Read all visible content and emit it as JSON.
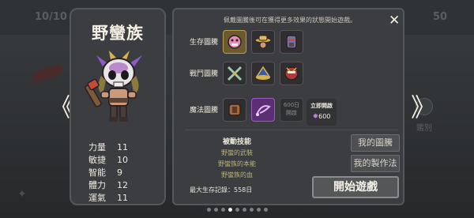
{
  "background": {
    "count_left": "10/10",
    "count_right": "50",
    "badge_label": "鑑別"
  },
  "nav": {
    "prev": "《",
    "next": "》"
  },
  "character": {
    "name": "野蠻族",
    "stats": [
      {
        "label": "力量",
        "value": "11"
      },
      {
        "label": "敏捷",
        "value": "10"
      },
      {
        "label": "智能",
        "value": "9"
      },
      {
        "label": "體力",
        "value": "12"
      },
      {
        "label": "運氣",
        "value": "11"
      }
    ]
  },
  "panel": {
    "hint": "佩戴圖騰後可在獲得更多效果的狀態開始遊戲。",
    "close": "✕",
    "categories": [
      {
        "label": "生存圖騰",
        "icons": [
          "pink-monster-totem-icon",
          "straw-hat-totem-icon",
          "armored-warrior-totem-icon"
        ]
      },
      {
        "label": "戰鬥圖騰",
        "icons": [
          "crossed-swords-totem-icon",
          "mage-hat-totem-icon",
          "red-mask-totem-icon"
        ]
      },
      {
        "label": "魔法圖騰",
        "icons": [
          "bronze-armor-totem-icon",
          "purple-whip-totem-icon"
        ]
      }
    ],
    "locked_cost": "600日",
    "locked_label": "開啟",
    "unlock_title": "立即開啟",
    "unlock_cost": "600",
    "passive_title": "被動技能",
    "passive_skills": [
      "野蠻的武裝",
      "野蠻族的本能",
      "野蠻族的血"
    ],
    "record": "最大生存記錄：558日",
    "my_totem_button": "我的圖騰",
    "my_craft_button": "我的製作法",
    "start_button": "開始遊戲"
  },
  "pagination": {
    "count": 9,
    "active_index": 3
  },
  "colors": {
    "panel_bg": "#3b3d40",
    "gold_tile": "#6b5a2d",
    "purple_tile": "#5b2f73",
    "gem": "#c77ce8",
    "skill_text": "#b9b27d"
  }
}
